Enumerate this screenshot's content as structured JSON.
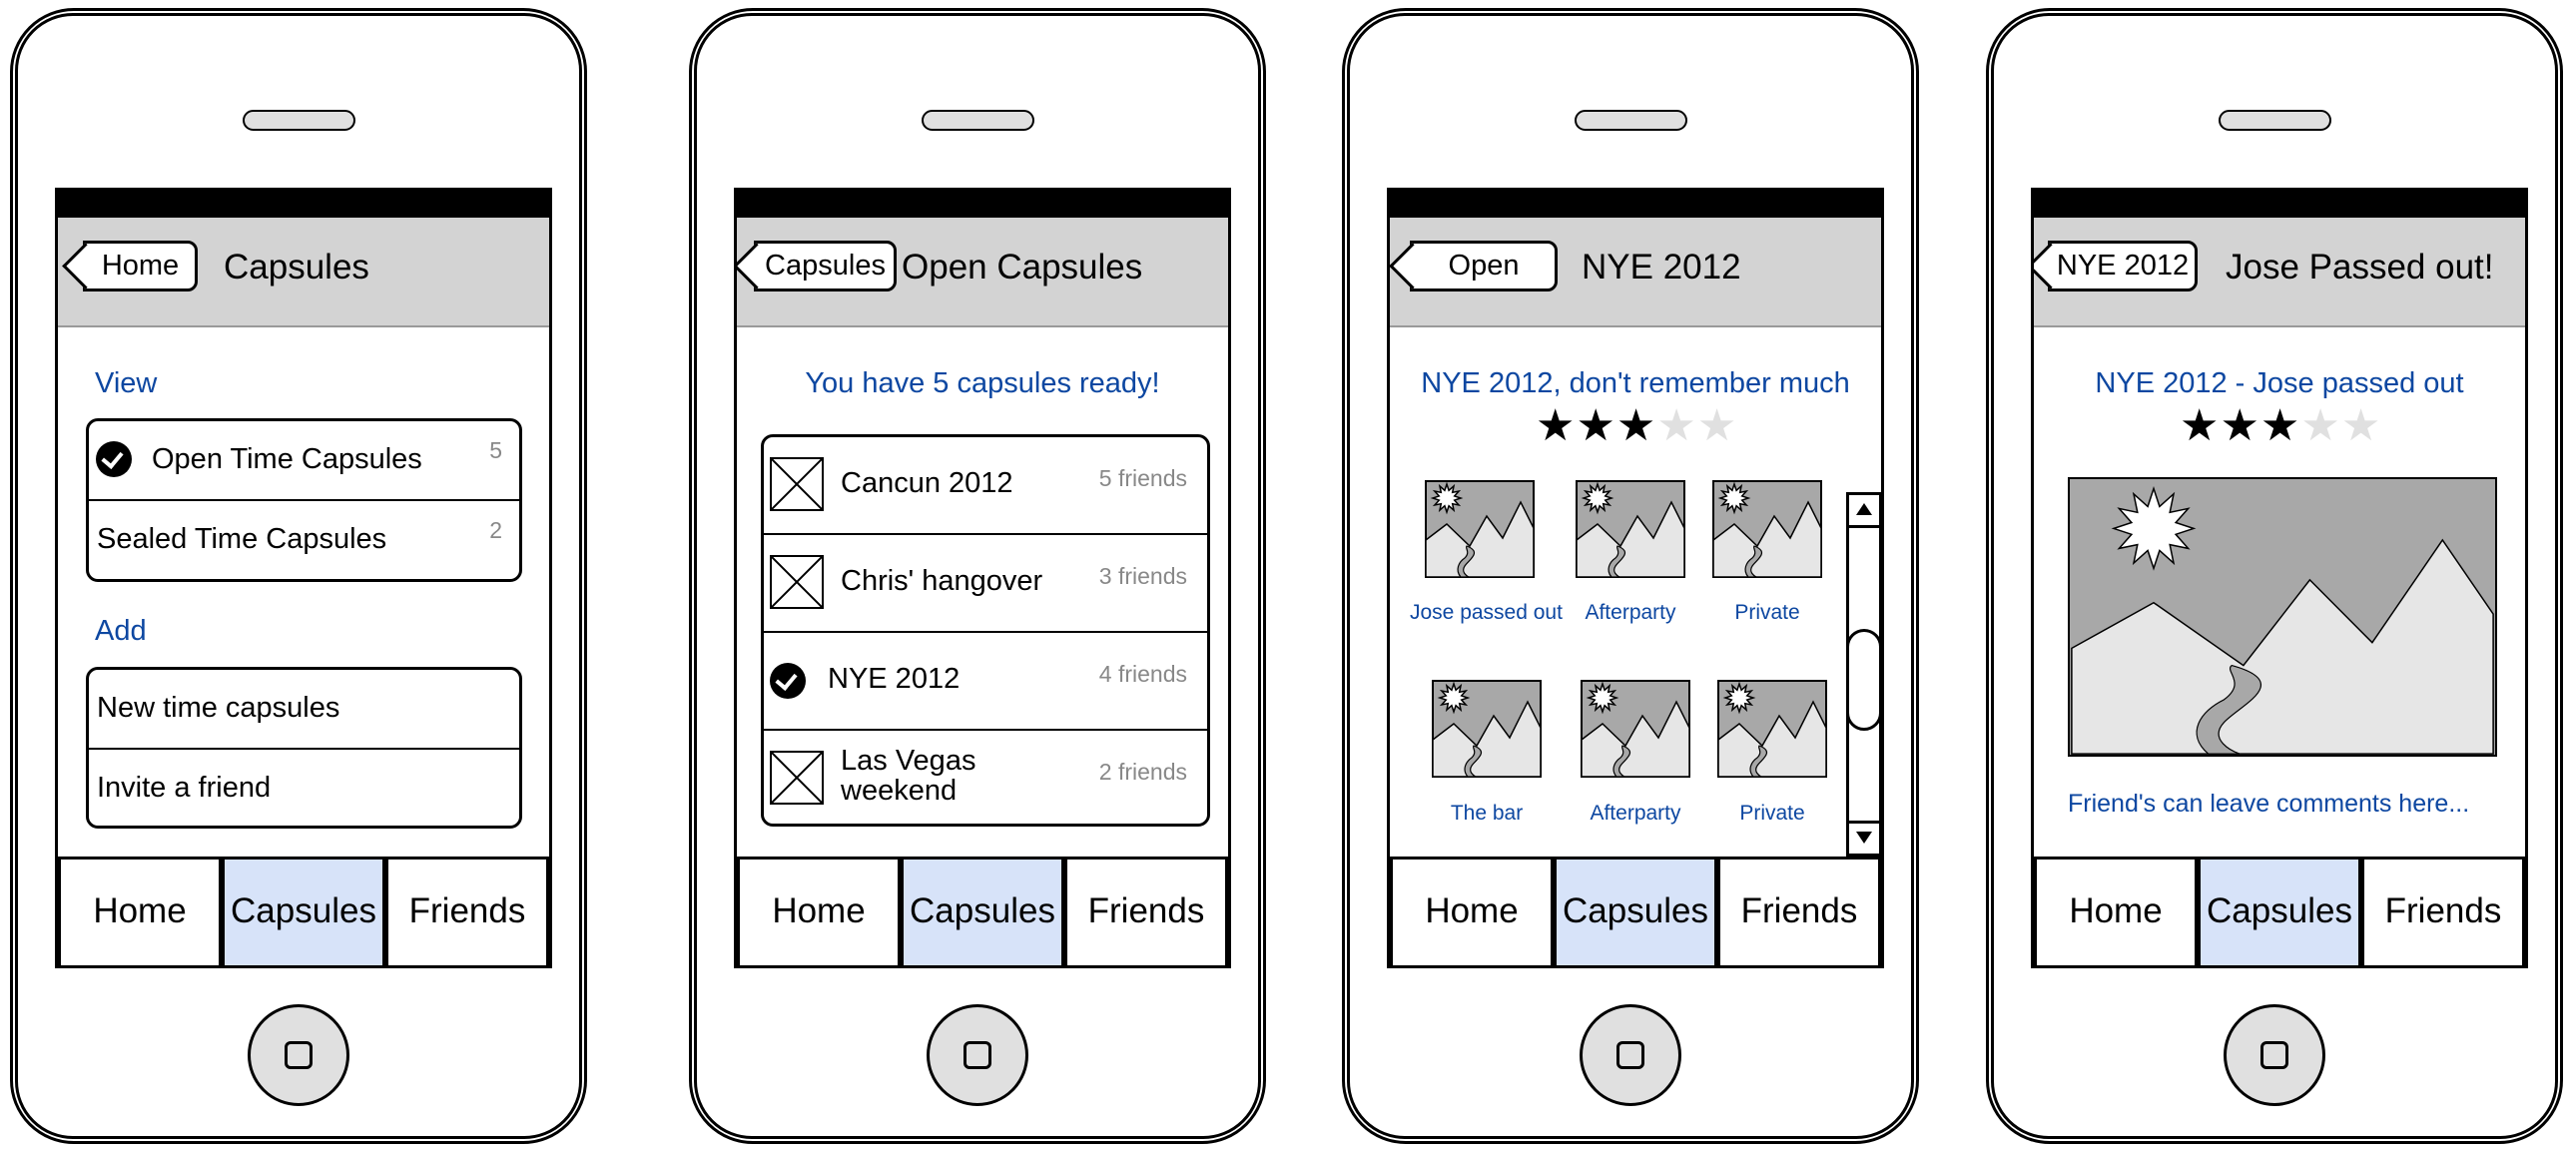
{
  "screens": [
    {
      "nav": {
        "back": "Home",
        "title": "Capsules"
      },
      "view_heading": "View",
      "view_items": [
        {
          "label": "Open Time Capsules",
          "count": "5",
          "checked": true
        },
        {
          "label": "Sealed Time Capsules",
          "count": "2",
          "checked": false
        }
      ],
      "add_heading": "Add",
      "add_items": [
        {
          "label": "New time capsules"
        },
        {
          "label": "Invite a friend"
        }
      ]
    },
    {
      "nav": {
        "back": "Capsules",
        "title": "Open Capsules"
      },
      "heading": "You have 5 capsules ready!",
      "capsules": [
        {
          "name": "Cancun 2012",
          "friends": "5 friends",
          "icon": "image-placeholder-icon"
        },
        {
          "name": "Chris' hangover",
          "friends": "3 friends",
          "icon": "image-placeholder-icon"
        },
        {
          "name": "NYE 2012",
          "friends": "4 friends",
          "icon": "check-circle-icon"
        },
        {
          "name": "Las Vegas\nweekend",
          "friends": "2 friends",
          "icon": "image-placeholder-icon"
        }
      ]
    },
    {
      "nav": {
        "back": "Open",
        "title": "NYE 2012"
      },
      "heading": "NYE 2012, don't remember much",
      "rating": 3,
      "rating_max": 5,
      "photos": [
        {
          "label": "Jose passed out"
        },
        {
          "label": "Afterparty"
        },
        {
          "label": "Private"
        },
        {
          "label": "The bar"
        },
        {
          "label": "Afterparty"
        },
        {
          "label": "Private"
        }
      ]
    },
    {
      "nav": {
        "back": "NYE 2012",
        "title": "Jose Passed out!"
      },
      "heading": "NYE 2012 - Jose passed out",
      "rating": 3,
      "rating_max": 5,
      "comment_prompt": "Friend's can leave comments here..."
    }
  ],
  "tabs": [
    "Home",
    "Capsules",
    "Friends"
  ],
  "active_tab": "Capsules",
  "colors": {
    "link": "#0d47a1",
    "nav_bg": "#d3d3d3",
    "active_tab": "#d7e3f9"
  }
}
